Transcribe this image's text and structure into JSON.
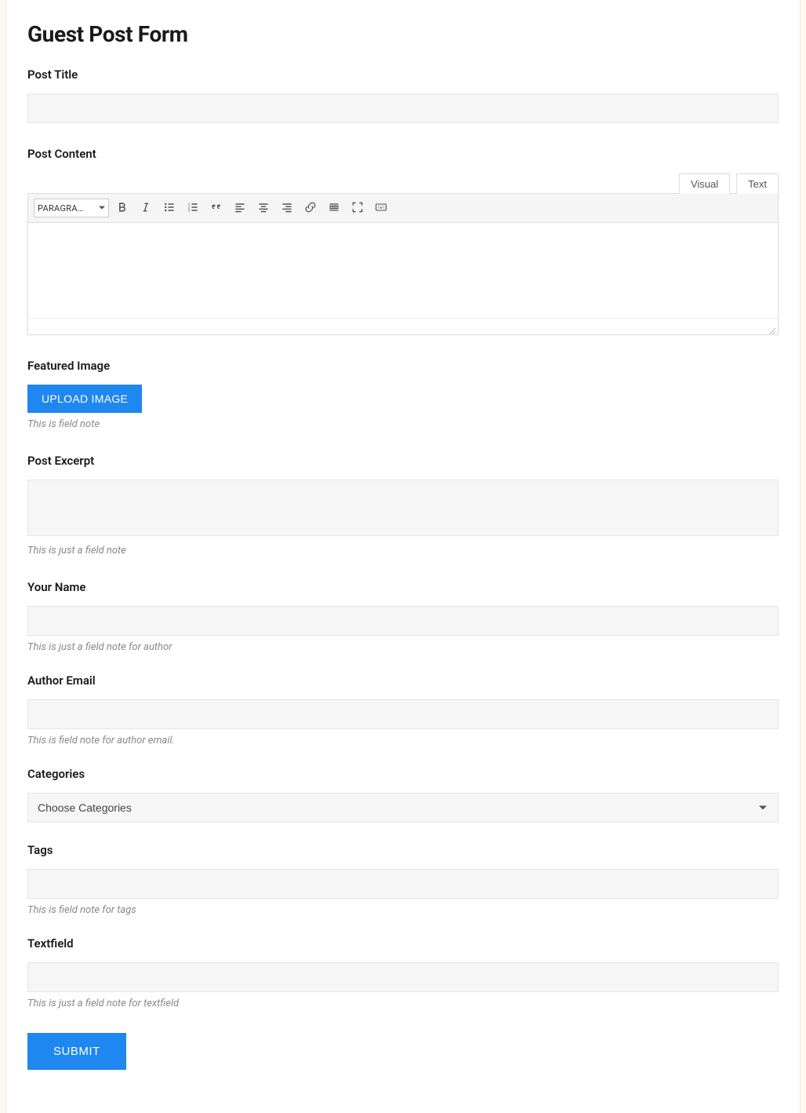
{
  "page": {
    "title": "Guest Post Form"
  },
  "fields": {
    "postTitle": {
      "label": "Post Title",
      "value": ""
    },
    "postContent": {
      "label": "Post Content"
    },
    "featuredImage": {
      "label": "Featured Image",
      "buttonLabel": "UPLOAD IMAGE",
      "note": "This is field note"
    },
    "postExcerpt": {
      "label": "Post Excerpt",
      "value": "",
      "note": "This is just a field note"
    },
    "yourName": {
      "label": "Your Name",
      "value": "",
      "note": "This is just a field note for author"
    },
    "authorEmail": {
      "label": "Author Email",
      "value": "",
      "note": "This is field note for author email."
    },
    "categories": {
      "label": "Categories",
      "placeholder": "Choose Categories"
    },
    "tags": {
      "label": "Tags",
      "value": "",
      "note": "This is field note for tags"
    },
    "textfield": {
      "label": "Textfield",
      "value": "",
      "note": "This is just a field note for textfield"
    }
  },
  "editor": {
    "tabs": {
      "visual": "Visual",
      "text": "Text"
    },
    "formatSelect": "PARAGRA…",
    "toolbar": {
      "bold": "Bold",
      "italic": "Italic",
      "bulletList": "Bulleted list",
      "numberList": "Numbered list",
      "quote": "Blockquote",
      "alignLeft": "Align left",
      "alignCenter": "Align center",
      "alignRight": "Align right",
      "link": "Insert link",
      "readMore": "Insert Read More tag",
      "fullscreen": "Fullscreen",
      "toolbarToggle": "Toolbar toggle"
    }
  },
  "submit": {
    "label": "SUBMIT"
  }
}
